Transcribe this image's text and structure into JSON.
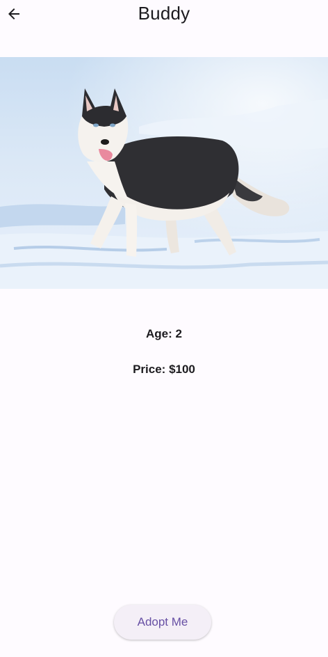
{
  "appbar": {
    "title": "Buddy",
    "back_icon": "arrow-left-icon"
  },
  "pet": {
    "photo_subject": "husky-dog-in-snow",
    "age_text": "Age: 2",
    "price_text": "Price: $100"
  },
  "actions": {
    "adopt_label": "Adopt Me"
  },
  "colors": {
    "background": "#fefbff",
    "text": "#1c1b1f",
    "accent": "#6750a4",
    "button_bg": "#f4eff7"
  }
}
